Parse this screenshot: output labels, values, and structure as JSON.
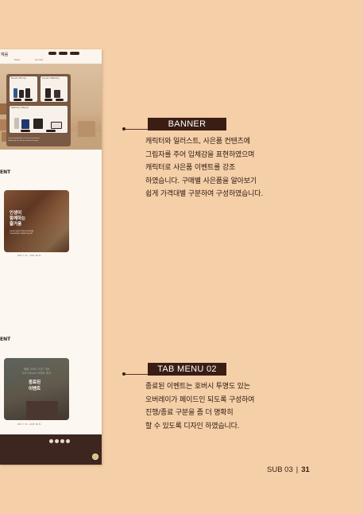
{
  "mockup": {
    "logo": "혜움",
    "nav": [
      "Event",
      "Account"
    ],
    "banner": {
      "card_titles": [
        "Tea set / Mini cup",
        "Cup set / Stationery",
        "Stationery / Bag set"
      ],
      "caption": "Lorem ipsum dolor sit amet consectetur adipiscing elit sed do eiusmod tempor"
    },
    "sections": {
      "ongoing_title": "ENT",
      "ended_title": "ENT"
    },
    "ongoing_card": {
      "title_line1": "인생이",
      "title_line2": "함께하는",
      "title_line3": "즐거움",
      "sub": "Lorem ipsum dolor sit amet consectetur adipiscing elit",
      "meta": "2023. 7. 01 ~ 2023. 08. 31"
    },
    "ended_card": {
      "faded_line1": "혜움 서비스 오픈 기념",
      "faded_line2": "우두 eBook 이벤트 행사",
      "title_line1": "종료된",
      "title_line2": "이벤트",
      "meta": "2023. 7. 01 ~ 2023. 08. 31"
    }
  },
  "callouts": {
    "banner": {
      "label": "BANNER",
      "text": "캐릭터와 일러스트, 사은품 컨텐츠에\n그림자를 주어 입체감을 표현하였으며\n캐릭터로 사은품 이벤트를 강조\n하였습니다. 구매별 사은품을 알아보기\n쉽게 가격대별 구분하여 구성하였습니다."
    },
    "tab_menu": {
      "label": "TAB MENU 02",
      "text": "종료된 이벤트는 호버시 투명도 있는\n 오버레이가 페이드인 되도록 구성하여\n진행/종료 구분을 좀 더 명확히\n할 수 있도록 디자인 하였습니다."
    }
  },
  "page_footer": {
    "section": "SUB 03",
    "page": "31"
  },
  "colors": {
    "background": "#f5cfa8",
    "accent_dark": "#3a1e14",
    "mock_footer": "#3e2620"
  }
}
